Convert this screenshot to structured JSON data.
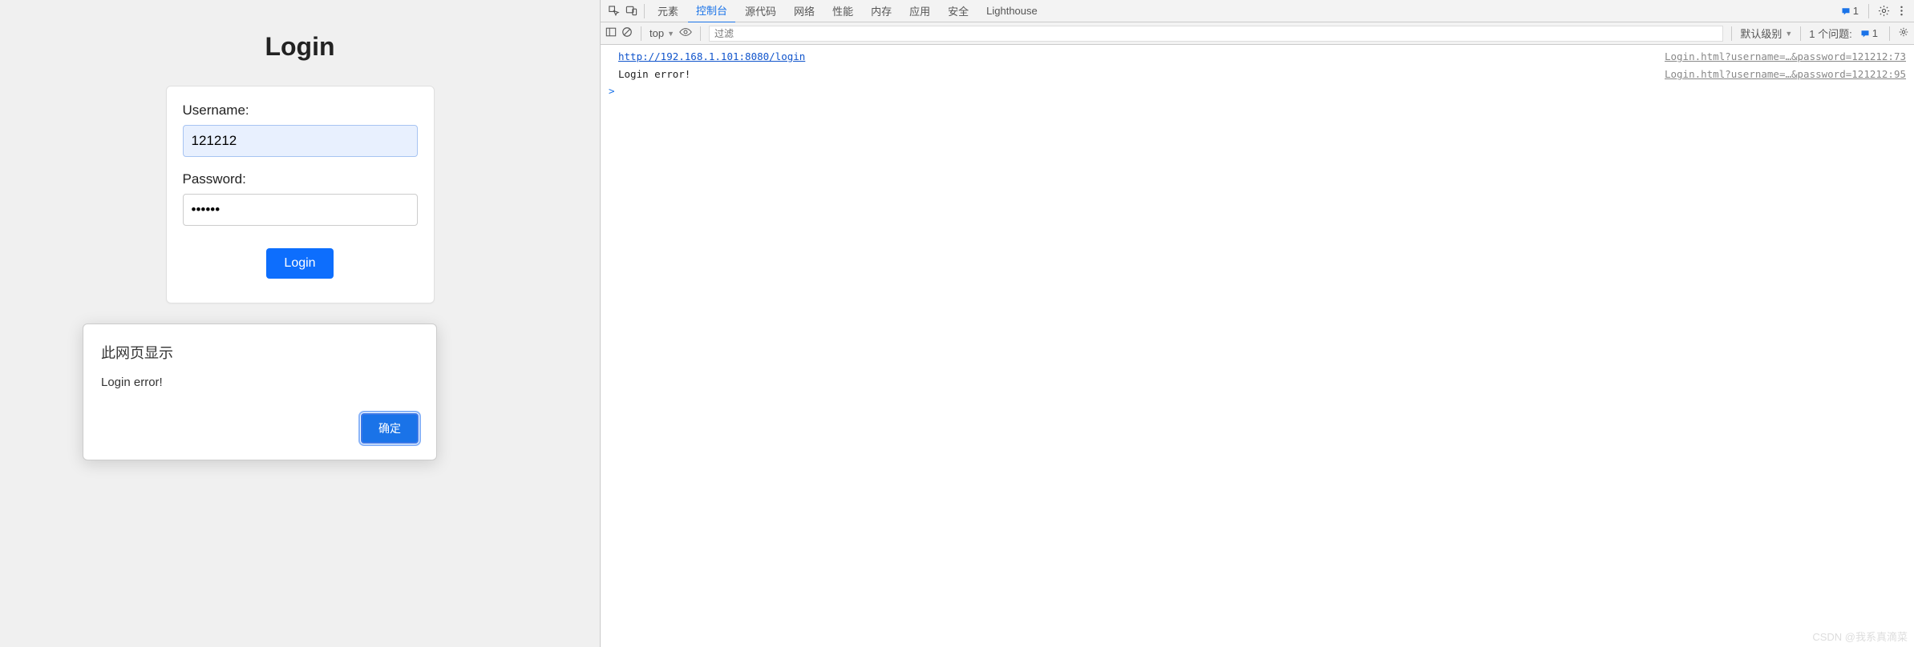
{
  "login": {
    "title": "Login",
    "username_label": "Username:",
    "username_value": "121212",
    "password_label": "Password:",
    "password_value": "••••••",
    "button": "Login"
  },
  "alert": {
    "title": "此网页显示",
    "message": "Login error!",
    "ok": "确定"
  },
  "devtools": {
    "tabs": {
      "elements": "元素",
      "console": "控制台",
      "sources": "源代码",
      "network": "网络",
      "performance": "性能",
      "memory": "内存",
      "application": "应用",
      "security": "安全",
      "lighthouse": "Lighthouse"
    },
    "badge_count": "1",
    "toolbar": {
      "context": "top",
      "filter_placeholder": "过滤",
      "levels": "默认级别",
      "issues_label": "1 个问题:",
      "issues_count": "1"
    },
    "console_rows": [
      {
        "msg": "http://192.168.1.101:8080/login",
        "is_link": true,
        "src": "Login.html?username=…&password=121212:73"
      },
      {
        "msg": "Login error!",
        "is_link": false,
        "src": "Login.html?username=…&password=121212:95"
      }
    ],
    "prompt": ">"
  },
  "watermark": "CSDN @我系真滴菜"
}
